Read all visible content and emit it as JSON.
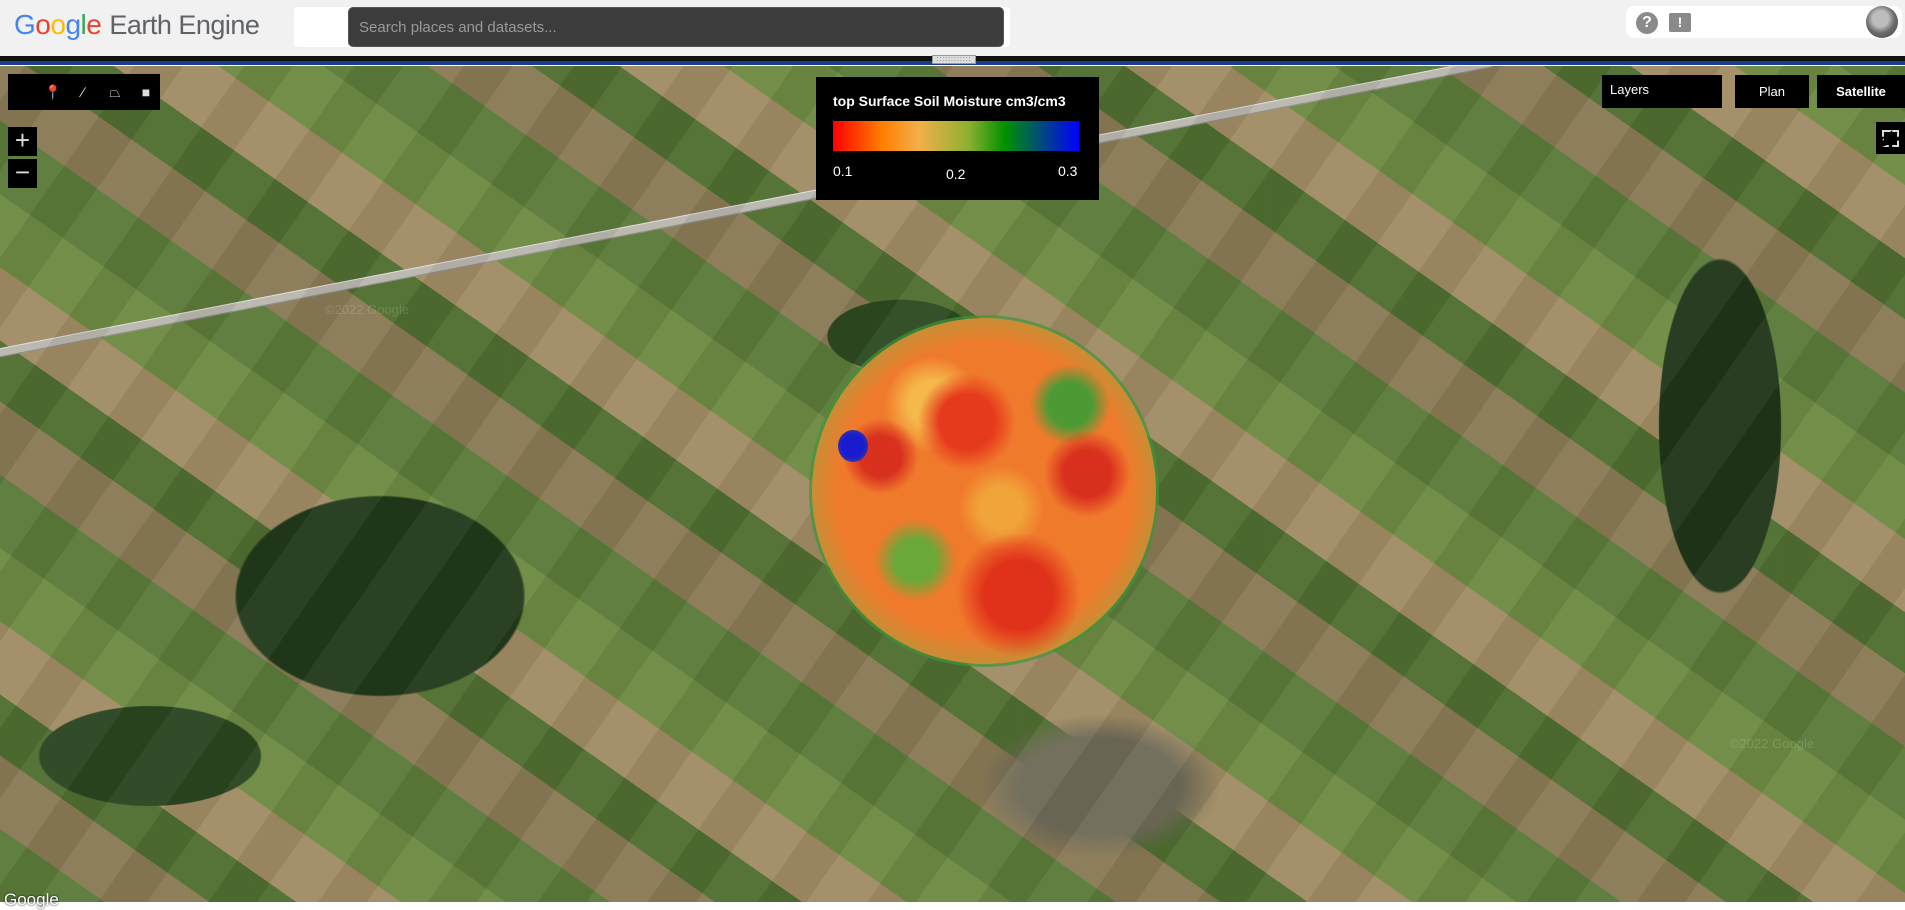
{
  "header": {
    "logo_google": [
      "G",
      "o",
      "o",
      "g",
      "l",
      "e"
    ],
    "logo_rest": "Earth Engine",
    "search_placeholder": "Search places and datasets...",
    "help_icon": "?",
    "feedback_icon": "!"
  },
  "drawing_tools": {
    "items": [
      {
        "icon": "marker-icon",
        "glyph": "📍"
      },
      {
        "icon": "line-icon",
        "glyph": "∕"
      },
      {
        "icon": "polygon-icon",
        "glyph": "⏢"
      },
      {
        "icon": "rectangle-icon",
        "glyph": "■"
      }
    ]
  },
  "zoom": {
    "in_label": "+",
    "out_label": "−"
  },
  "legend": {
    "title": "top Surface Soil Moisture cm3/cm3",
    "min": "0.1",
    "mid": "0.2",
    "max": "0.3",
    "palette": [
      "#ff0000",
      "#ff7f00",
      "#f2b04a",
      "#8db030",
      "#009000",
      "#0000ff"
    ]
  },
  "map_controls": {
    "layers_label": "Layers",
    "plan_label": "Plan",
    "satellite_label": "Satellite"
  },
  "map": {
    "attribution": "Google",
    "watermark": "©2022 Google"
  }
}
